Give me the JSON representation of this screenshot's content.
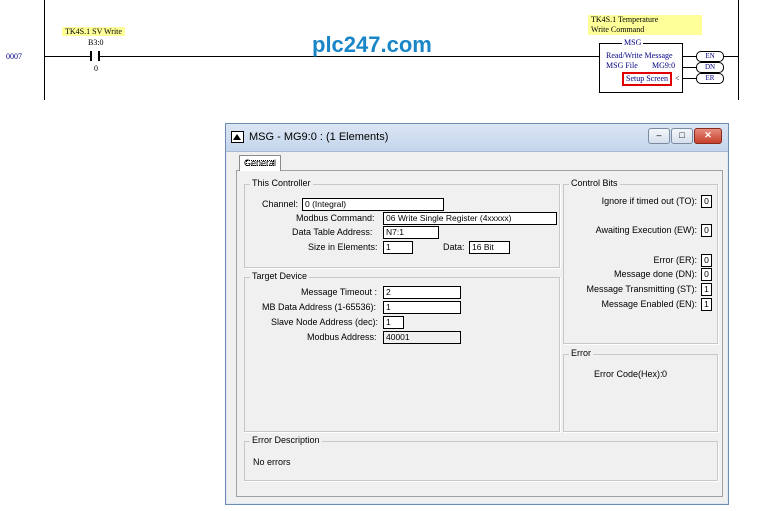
{
  "ladder": {
    "rung_number": "0007",
    "contact_title": "TK4S.1 SV Write",
    "contact_address": "B3:0",
    "contact_bit": "0",
    "watermark": "plc247.com",
    "msg_title_line1": "TK4S.1 Temperature",
    "msg_title_line2": "Write Command",
    "msg_header": "MSG",
    "msg_line1": "Read/Write Message",
    "msg_file_label": "MSG File",
    "msg_file_value": "MG9:0",
    "msg_setup": "Setup Screen",
    "msg_arrow": "<",
    "coil_en": "EN",
    "coil_dn": "DN",
    "coil_er": "ER"
  },
  "dialog": {
    "title": "MSG - MG9:0 : (1 Elements)",
    "minimize": "–",
    "maximize": "□",
    "close": "✕",
    "tab_general": "General",
    "this_controller": {
      "title": "This Controller",
      "channel_label": "Channel:",
      "channel_value": "0 (Integral)",
      "modbus_command_label": "Modbus Command:",
      "modbus_command_value": "06 Write Single Register (4xxxxx)",
      "data_table_label": "Data Table Address:",
      "data_table_value": "N7:1",
      "size_label": "Size in Elements:",
      "size_value": "1",
      "data_label": "Data:",
      "data_value": "16 Bit"
    },
    "target_device": {
      "title": "Target Device",
      "timeout_label": "Message Timeout :",
      "timeout_value": "2",
      "mb_address_label": "MB Data Address (1-65536):",
      "mb_address_value": "1",
      "slave_label": "Slave Node Address (dec):",
      "slave_value": "1",
      "modbus_address_label": "Modbus Address:",
      "modbus_address_value": "40001"
    },
    "control_bits": {
      "title": "Control Bits",
      "to_label": "Ignore if timed out (TO):",
      "to_value": "0",
      "ew_label": "Awaiting Execution (EW):",
      "ew_value": "0",
      "er_label": "Error (ER):",
      "er_value": "0",
      "dn_label": "Message done (DN):",
      "dn_value": "0",
      "st_label": "Message Transmitting (ST):",
      "st_value": "1",
      "en_label": "Message Enabled (EN):",
      "en_value": "1"
    },
    "error": {
      "title": "Error",
      "code_label": "Error Code(Hex):",
      "code_value": "0"
    },
    "error_description": {
      "title": "Error Description",
      "text": "No errors"
    }
  },
  "colors": {
    "watermark": "#1a86c8",
    "highlight_yellow": "#ffff99",
    "setup_border": "#e00000",
    "ladder_text": "#000080"
  }
}
